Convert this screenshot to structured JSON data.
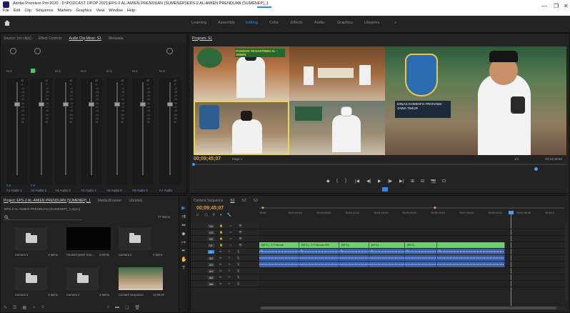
{
  "window": {
    "title": "Adobe Premiere Pro 2020 - D:\\PODCAST OPOP 2021\\EPS-2 AL-AMIEN PRENDUAN (SUMENEP)\\EPS-2 AL-AMIEN PRENDUAN (SUMENEP)_1",
    "menu": [
      "File",
      "Edit",
      "Clip",
      "Sequence",
      "Markers",
      "Graphics",
      "View",
      "Window",
      "Help"
    ],
    "controls": [
      "—",
      "❐",
      "✕"
    ]
  },
  "workspaces": [
    "Learning",
    "Assembly",
    "Editing",
    "Color",
    "Effects",
    "Audio",
    "Graphics",
    "Libraries",
    "»"
  ],
  "active_workspace": "Editing",
  "source_panel": {
    "tabs": [
      "Source: (no clips)",
      "Effect Controls",
      "Audio Clip Mixer: S1",
      "Metadata"
    ],
    "active_tab": "Audio Clip Mixer: S1",
    "channels": [
      {
        "id": "A1",
        "name": "Audio 1"
      },
      {
        "id": "A2",
        "name": "Audio 2"
      },
      {
        "id": "A3",
        "name": "Audio 3"
      },
      {
        "id": "A4",
        "name": "Audio 4"
      },
      {
        "id": "A5",
        "name": "Audio 5"
      },
      {
        "id": "A6",
        "name": "Audio 6"
      },
      {
        "id": "A7",
        "name": "Audio"
      }
    ],
    "meter_ticks": [
      "dB",
      "-6",
      "-12",
      "-18",
      "-24",
      "-30",
      "-36",
      "-42",
      "-48",
      "-54",
      "-60",
      "dB"
    ],
    "bottom_values": [
      "0.0",
      "0.0"
    ]
  },
  "program_panel": {
    "tab": "Program: S1",
    "timecode": "00;09;45;07",
    "fit": "Page 1",
    "scale": "1/4",
    "duration": "00;10;48;58",
    "lower_third_1": "PONDOK PESANTREN AL - AMIEN",
    "lower_third_2": "DINAS KOMINFO PROVINSI JAWA TIMUR",
    "transport": [
      "◆",
      "{",
      "}",
      "|◀",
      "◀|",
      "▶",
      "|▶",
      "▶|",
      "⊞",
      "⊟",
      "📷",
      "⊡"
    ]
  },
  "project_panel": {
    "tabs": [
      "Project: EPS-2 AL-AMIEN PRENDUAN (SUMENEP)_1",
      "Media Browser",
      "Libraries"
    ],
    "path": "EPS-2 AL-AMIEN PRENDUAN (SUMENEP)_1.prproj",
    "count": "27 items",
    "items": [
      {
        "name": "Camera 1",
        "count": "4 Items",
        "kind": "folder"
      },
      {
        "name": "Unused green scre...",
        "count": "3;00;56",
        "kind": "black"
      },
      {
        "name": "Camera 2",
        "count": "4 Items",
        "kind": "folder"
      },
      {
        "name": "Camera 3",
        "count": "3 Items",
        "kind": "folder"
      },
      {
        "name": "Camera 4",
        "count": "3 Items",
        "kind": "folder"
      },
      {
        "name": "Content Sequence",
        "count": "11;09;20",
        "kind": "video"
      }
    ]
  },
  "timeline_panel": {
    "tabs": [
      "Content Sequence",
      "S1",
      "S2",
      "S3"
    ],
    "active_tab": "S1",
    "timecode": "00;09;45;07",
    "ruler": [
      "00;00",
      "00;01;04;04",
      "00;02;08;08",
      "00;03;12;12",
      "00;04;16;16",
      "00;05;20;20",
      "00;06;24;24",
      "00;07;28;28",
      "00;08;32;32",
      "00;09;36;36",
      "00;10;4"
    ],
    "video_tracks": [
      "V4",
      "V3",
      "V2",
      "V1"
    ],
    "audio_tracks": [
      "A1",
      "A2",
      "A3",
      "A4",
      "A5",
      "A6"
    ],
    "clips_v1": [
      "[MC1] - 17 Februar",
      "[MC1] - 17 Februari 202",
      "[MC1]-",
      "[MC1]-",
      "[MC1] -"
    ],
    "audio_label": "fx"
  },
  "colors": {
    "accent": "#2d8ceb",
    "timecode": "#d9a441",
    "video_clip": "#6fcf6f",
    "audio_clip": "#3a5ea8",
    "playhead": "#4a9bef"
  }
}
